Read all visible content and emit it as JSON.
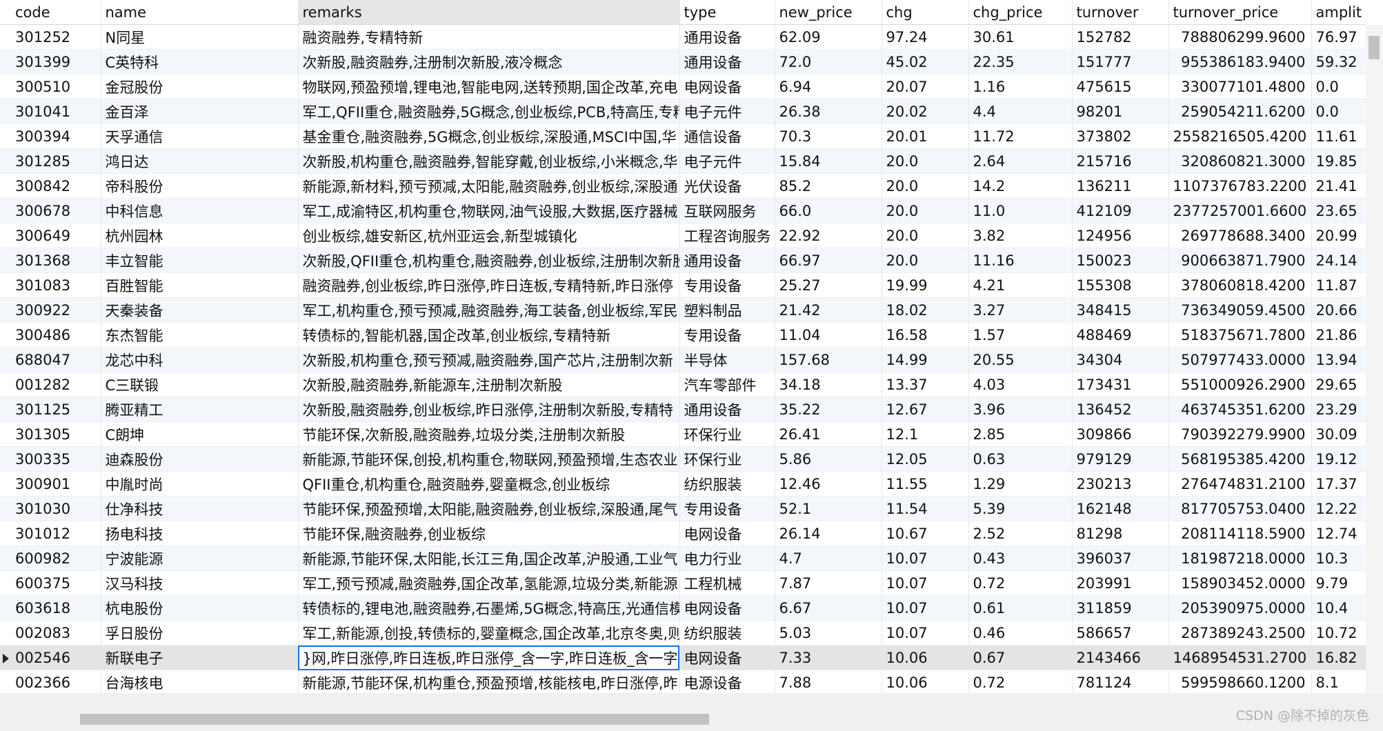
{
  "columns": [
    "code",
    "name",
    "remarks",
    "type",
    "new_price",
    "chg",
    "chg_price",
    "turnover",
    "turnover_price",
    "amplit"
  ],
  "rows": [
    [
      "301252",
      "N同星",
      "融资融券,专精特新",
      "通用设备",
      "62.09",
      "97.24",
      "30.61",
      "152782",
      "788806299.9600",
      "76.97"
    ],
    [
      "301399",
      "C英特科",
      "次新股,融资融券,注册制次新股,液冷概念",
      "通用设备",
      "72.0",
      "45.02",
      "22.35",
      "151777",
      "955386183.9400",
      "59.32"
    ],
    [
      "300510",
      "金冠股份",
      "物联网,预盈预增,锂电池,智能电网,送转预期,国企改革,充电",
      "电网设备",
      "6.94",
      "20.07",
      "1.16",
      "475615",
      "330077101.4800",
      "0.0"
    ],
    [
      "301041",
      "金百泽",
      "军工,QFII重仓,融资融券,5G概念,创业板综,PCB,特高压,专精",
      "电子元件",
      "26.38",
      "20.02",
      "4.4",
      "98201",
      "259054211.6200",
      "0.0"
    ],
    [
      "300394",
      "天孚通信",
      "基金重仓,融资融券,5G概念,创业板综,深股通,MSCI中国,华",
      "通信设备",
      "70.3",
      "20.01",
      "11.72",
      "373802",
      "2558216505.4200",
      "11.61"
    ],
    [
      "301285",
      "鸿日达",
      "次新股,机构重仓,融资融券,智能穿戴,创业板综,小米概念,华",
      "电子元件",
      "15.84",
      "20.0",
      "2.64",
      "215716",
      "320860821.3000",
      "19.85"
    ],
    [
      "300842",
      "帝科股份",
      "新能源,新材料,预亏预减,太阳能,融资融券,创业板综,深股通",
      "光伏设备",
      "85.2",
      "20.0",
      "14.2",
      "136211",
      "1107376783.2200",
      "21.41"
    ],
    [
      "300678",
      "中科信息",
      "军工,成渝特区,机构重仓,物联网,油气设服,大数据,医疗器械",
      "互联网服务",
      "66.0",
      "20.0",
      "11.0",
      "412109",
      "2377257001.6600",
      "23.65"
    ],
    [
      "300649",
      "杭州园林",
      "创业板综,雄安新区,杭州亚运会,新型城镇化",
      "工程咨询服务",
      "22.92",
      "20.0",
      "3.82",
      "124956",
      "269778688.3400",
      "20.99"
    ],
    [
      "301368",
      "丰立智能",
      "次新股,QFII重仓,机构重仓,融资融券,创业板综,注册制次新股",
      "通用设备",
      "66.97",
      "20.0",
      "11.16",
      "150023",
      "900663871.7900",
      "24.14"
    ],
    [
      "301083",
      "百胜智能",
      "融资融券,创业板综,昨日涨停,昨日连板,专精特新,昨日涨停",
      "专用设备",
      "25.27",
      "19.99",
      "4.21",
      "155308",
      "378060818.4200",
      "11.87"
    ],
    [
      "300922",
      "天秦装备",
      "军工,机构重仓,预亏预减,融资融券,海工装备,创业板综,军民",
      "塑料制品",
      "21.42",
      "18.02",
      "3.27",
      "348415",
      "736349059.4500",
      "20.66"
    ],
    [
      "300486",
      "东杰智能",
      "转债标的,智能机器,国企改革,创业板综,专精特新",
      "专用设备",
      "11.04",
      "16.58",
      "1.57",
      "488469",
      "518375671.7800",
      "21.86"
    ],
    [
      "688047",
      "龙芯中科",
      "次新股,机构重仓,预亏预减,融资融券,国产芯片,注册制次新",
      "半导体",
      "157.68",
      "14.99",
      "20.55",
      "34304",
      "507977433.0000",
      "13.94"
    ],
    [
      "001282",
      "C三联锻",
      "次新股,融资融券,新能源车,注册制次新股",
      "汽车零部件",
      "34.18",
      "13.37",
      "4.03",
      "173431",
      "551000926.2900",
      "29.65"
    ],
    [
      "301125",
      "腾亚精工",
      "次新股,融资融券,创业板综,昨日涨停,注册制次新股,专精特",
      "通用设备",
      "35.22",
      "12.67",
      "3.96",
      "136452",
      "463745351.6200",
      "23.29"
    ],
    [
      "301305",
      "C朗坤",
      "节能环保,次新股,融资融券,垃圾分类,注册制次新股",
      "环保行业",
      "26.41",
      "12.1",
      "2.85",
      "309866",
      "790392279.9900",
      "30.09"
    ],
    [
      "300335",
      "迪森股份",
      "新能源,节能环保,创投,机构重仓,物联网,预盈预增,生态农业",
      "环保行业",
      "5.86",
      "12.05",
      "0.63",
      "979129",
      "568195385.4200",
      "19.12"
    ],
    [
      "300901",
      "中胤时尚",
      "QFII重仓,机构重仓,融资融券,婴童概念,创业板综",
      "纺织服装",
      "12.46",
      "11.55",
      "1.29",
      "230213",
      "276474831.2100",
      "17.37"
    ],
    [
      "301030",
      "仕净科技",
      "节能环保,预盈预增,太阳能,融资融券,创业板综,深股通,尾气",
      "专用设备",
      "52.1",
      "11.54",
      "5.39",
      "162148",
      "817705753.0400",
      "12.22"
    ],
    [
      "301012",
      "扬电科技",
      "节能环保,融资融券,创业板综",
      "电网设备",
      "26.14",
      "10.67",
      "2.52",
      "81298",
      "208114118.5900",
      "12.74"
    ],
    [
      "600982",
      "宁波能源",
      "新能源,节能环保,太阳能,长江三角,国企改革,沪股通,工业气",
      "电力行业",
      "4.7",
      "10.07",
      "0.43",
      "396037",
      "181987218.0000",
      "10.3"
    ],
    [
      "600375",
      "汉马科技",
      "军工,预亏预减,融资融券,国企改革,氢能源,垃圾分类,新能源",
      "工程机械",
      "7.87",
      "10.07",
      "0.72",
      "203991",
      "158903452.0000",
      "9.79"
    ],
    [
      "603618",
      "杭电股份",
      "转债标的,锂电池,融资融券,石墨烯,5G概念,特高压,光通信模",
      "电网设备",
      "6.67",
      "10.07",
      "0.61",
      "311859",
      "205390975.0000",
      "10.4"
    ],
    [
      "002083",
      "孚日股份",
      "军工,新能源,创投,转债标的,婴童概念,国企改革,北京冬奥,则",
      "纺织服装",
      "5.03",
      "10.07",
      "0.46",
      "586657",
      "287389243.2500",
      "10.72"
    ],
    [
      "002546",
      "新联电子",
      "}网,昨日涨停,昨日连板,昨日涨停_含一字,昨日连板_含一字",
      "电网设备",
      "7.33",
      "10.06",
      "0.67",
      "2143466",
      "1468954531.2700",
      "16.82"
    ],
    [
      "002366",
      "台海核电",
      "新能源,节能环保,机构重仓,预盈预增,核能核电,昨日涨停,昨",
      "电源设备",
      "7.88",
      "10.06",
      "0.72",
      "781124",
      "599598660.1200",
      "8.1"
    ]
  ],
  "selected_row_index": 25,
  "editing_column": "remarks",
  "sorted_column": "remarks",
  "watermark": "CSDN @除不掉的灰色"
}
